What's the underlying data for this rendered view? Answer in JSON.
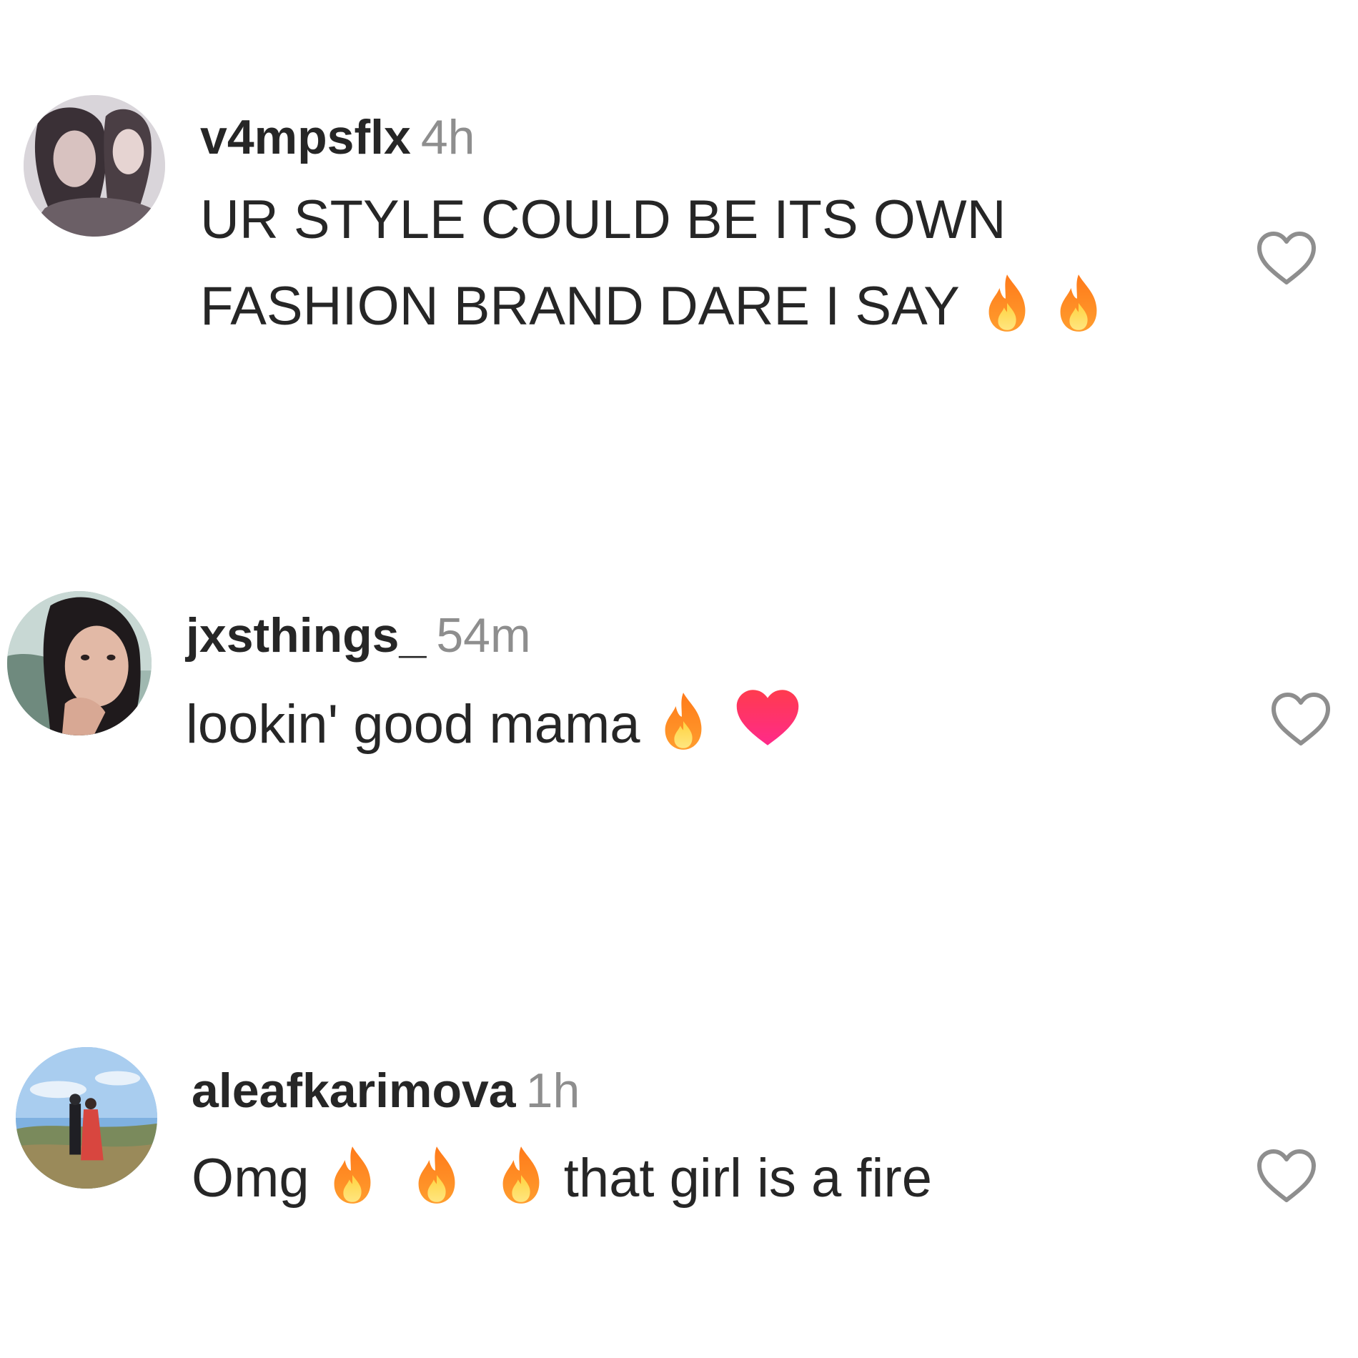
{
  "comments": [
    {
      "username": "v4mpsflx",
      "time": "4h",
      "text_lines": [
        "UR STYLE COULD BE ITS OWN",
        "FASHION BRAND DARE I SAY"
      ],
      "emojis": [
        "fire-emoji",
        "fire-emoji"
      ],
      "like_icon": "heart-outline-icon"
    },
    {
      "username": "jxsthings_",
      "time": "54m",
      "text_lines": [
        "lookin' good mama"
      ],
      "emojis": [
        "fire-emoji",
        "red-heart-emoji"
      ],
      "like_icon": "heart-outline-icon"
    },
    {
      "username": "aleafkarimova",
      "time": "1h",
      "text_lines": [
        "Omg",
        "that girl is a fire"
      ],
      "emojis": [
        "fire-emoji",
        "fire-emoji",
        "fire-emoji"
      ],
      "like_icon": "heart-outline-icon"
    }
  ],
  "colors": {
    "username": "#262626",
    "timestamp": "#8e8e8e",
    "text": "#262626",
    "like_icon": "#8e8e8e"
  }
}
